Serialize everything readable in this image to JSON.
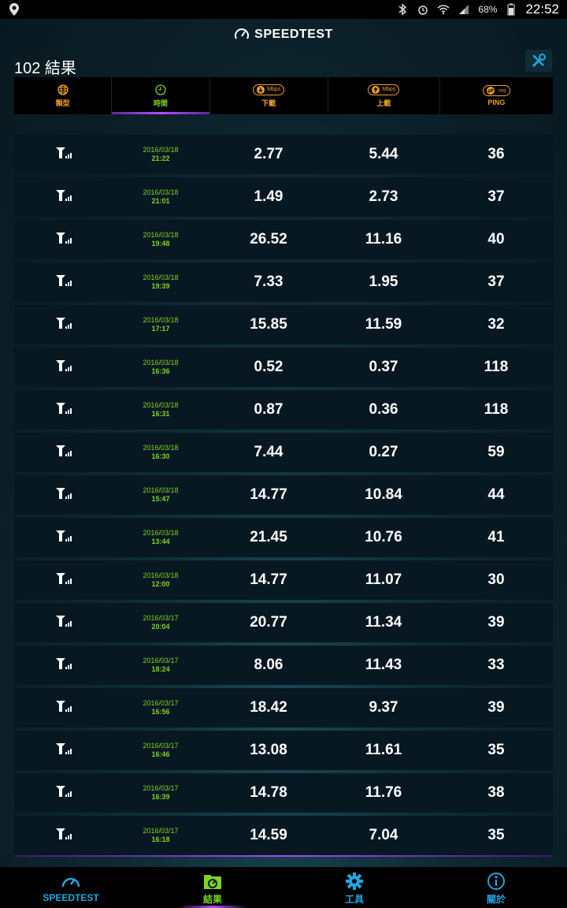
{
  "status_bar": {
    "battery": "68%",
    "time": "22:52"
  },
  "header": {
    "brand": "SPEEDTEST",
    "result_count": "102 結果"
  },
  "columns": [
    {
      "label": "類型",
      "icon": "globe-icon"
    },
    {
      "label": "時間",
      "icon": "clock-icon"
    },
    {
      "label": "下載",
      "icon": "download-icon",
      "unit": "Mbps"
    },
    {
      "label": "上載",
      "icon": "upload-icon",
      "unit": "Mbps"
    },
    {
      "label": "PING",
      "icon": "ping-icon",
      "unit": "ms"
    }
  ],
  "rows": [
    {
      "date": "2016/03/18",
      "time": "21:22",
      "download": "2.77",
      "upload": "5.44",
      "ping": "36"
    },
    {
      "date": "2016/03/18",
      "time": "21:01",
      "download": "1.49",
      "upload": "2.73",
      "ping": "37"
    },
    {
      "date": "2016/03/18",
      "time": "19:48",
      "download": "26.52",
      "upload": "11.16",
      "ping": "40"
    },
    {
      "date": "2016/03/18",
      "time": "19:39",
      "download": "7.33",
      "upload": "1.95",
      "ping": "37"
    },
    {
      "date": "2016/03/18",
      "time": "17:17",
      "download": "15.85",
      "upload": "11.59",
      "ping": "32"
    },
    {
      "date": "2016/03/18",
      "time": "16:36",
      "download": "0.52",
      "upload": "0.37",
      "ping": "118"
    },
    {
      "date": "2016/03/18",
      "time": "16:31",
      "download": "0.87",
      "upload": "0.36",
      "ping": "118"
    },
    {
      "date": "2016/03/18",
      "time": "16:30",
      "download": "7.44",
      "upload": "0.27",
      "ping": "59"
    },
    {
      "date": "2016/03/18",
      "time": "15:47",
      "download": "14.77",
      "upload": "10.84",
      "ping": "44"
    },
    {
      "date": "2016/03/18",
      "time": "13:44",
      "download": "21.45",
      "upload": "10.76",
      "ping": "41"
    },
    {
      "date": "2016/03/18",
      "time": "12:00",
      "download": "14.77",
      "upload": "11.07",
      "ping": "30"
    },
    {
      "date": "2016/03/17",
      "time": "20:04",
      "download": "20.77",
      "upload": "11.34",
      "ping": "39"
    },
    {
      "date": "2016/03/17",
      "time": "18:24",
      "download": "8.06",
      "upload": "11.43",
      "ping": "33"
    },
    {
      "date": "2016/03/17",
      "time": "16:56",
      "download": "18.42",
      "upload": "9.37",
      "ping": "39"
    },
    {
      "date": "2016/03/17",
      "time": "16:46",
      "download": "13.08",
      "upload": "11.61",
      "ping": "35"
    },
    {
      "date": "2016/03/17",
      "time": "16:39",
      "download": "14.78",
      "upload": "11.76",
      "ping": "38"
    },
    {
      "date": "2016/03/17",
      "time": "16:18",
      "download": "14.59",
      "upload": "7.04",
      "ping": "35"
    }
  ],
  "nav": [
    {
      "label": "SPEEDTEST",
      "icon": "speedometer-icon",
      "color": "#1ea7e0"
    },
    {
      "label": "結果",
      "icon": "results-folder-icon",
      "color": "#7ed321"
    },
    {
      "label": "工具",
      "icon": "gear-icon",
      "color": "#1ea7e0"
    },
    {
      "label": "關於",
      "icon": "info-icon",
      "color": "#1ea7e0"
    }
  ],
  "colors": {
    "accent_orange": "#f0a020",
    "accent_green": "#7ed321",
    "accent_blue": "#1ea7e0",
    "accent_purple": "#b14cff"
  }
}
